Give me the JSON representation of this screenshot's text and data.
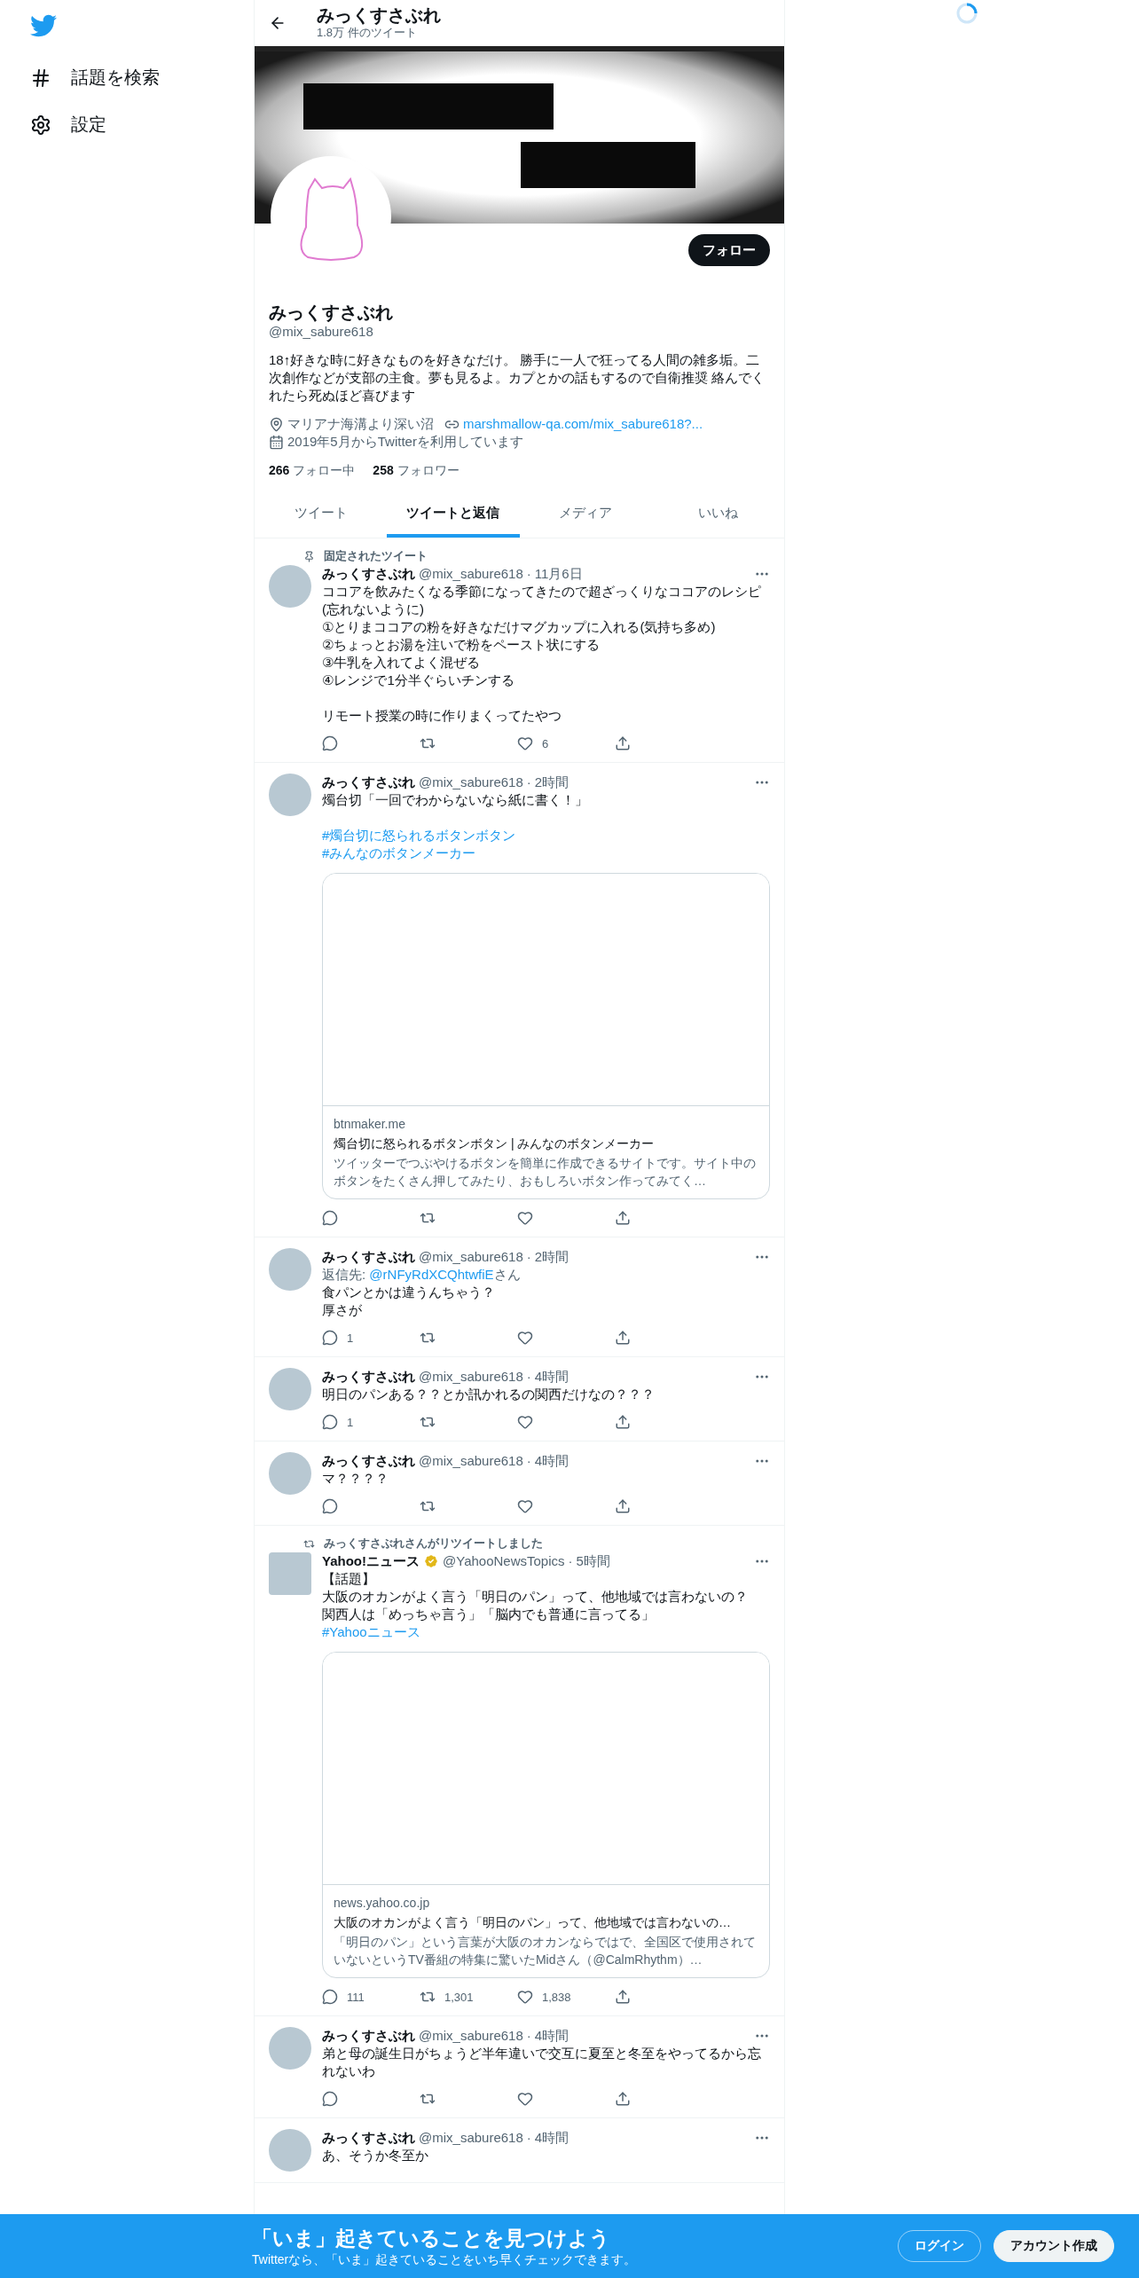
{
  "sidebar": {
    "nav": [
      {
        "kind": "hashtag",
        "label": "話題を検索"
      },
      {
        "kind": "settings",
        "label": "設定"
      }
    ]
  },
  "header": {
    "title": "みっくすさぶれ",
    "subtitle": "1.8万 件のツイート"
  },
  "profile": {
    "name": "みっくすさぶれ",
    "handle": "@mix_sabure618",
    "follow_button": "フォロー",
    "bio": "18↑好きな時に好きなものを好きなだけ。 勝手に一人で狂ってる人間の雑多垢。二次創作などが支部の主食。夢も見るよ。カプとかの話もするので自衛推奨 絡んでくれたら死ぬほど喜びます",
    "location": "マリアナ海溝より深い沼",
    "website": "marshmallow-qa.com/mix_sabure618?...",
    "joined": "2019年5月からTwitterを利用しています",
    "following_count": "266",
    "following_label": "フォロー中",
    "followers_count": "258",
    "followers_label": "フォロワー"
  },
  "tabs": [
    {
      "label": "ツイート",
      "selected": false
    },
    {
      "label": "ツイートと返信",
      "selected": true
    },
    {
      "label": "メディア",
      "selected": false
    },
    {
      "label": "いいね",
      "selected": false
    }
  ],
  "tweets": [
    {
      "context": {
        "kind": "pinned",
        "text": "固定されたツイート"
      },
      "avatar": {
        "kind": "circle"
      },
      "name": "みっくすさぶれ",
      "verified": false,
      "handle": "@mix_sabure618",
      "time": "11月6日",
      "separator": "·",
      "body": [
        {
          "kind": "text",
          "text": "ココアを飲みたくなる季節になってきたので超ざっくりなココアのレシピ(忘れないように)"
        },
        {
          "kind": "text",
          "text": "①とりまココアの粉を好きなだけマグカップに入れる(気持ち多め)"
        },
        {
          "kind": "text",
          "text": "②ちょっとお湯を注いで粉をペースト状にする"
        },
        {
          "kind": "text",
          "text": "③牛乳を入れてよく混ぜる"
        },
        {
          "kind": "text",
          "text": "④レンジで1分半ぐらいチンする"
        },
        {
          "kind": "gap"
        },
        {
          "kind": "text",
          "text": "リモート授業の時に作りまくってたやつ"
        }
      ],
      "actions": [
        {
          "kind": "reply"
        },
        {
          "kind": "retweet"
        },
        {
          "kind": "like",
          "count": "6"
        },
        {
          "kind": "share"
        }
      ]
    },
    {
      "avatar": {
        "kind": "circle"
      },
      "name": "みっくすさぶれ",
      "verified": false,
      "handle": "@mix_sabure618",
      "time": "2時間",
      "separator": "·",
      "body": [
        {
          "kind": "text",
          "text": "燭台切「一回でわからないなら紙に書く！」"
        },
        {
          "kind": "gap"
        },
        {
          "kind": "tag",
          "text": "#燭台切に怒られるボタンボタン"
        },
        {
          "kind": "tag",
          "text": "#みんなのボタンメーカー"
        }
      ],
      "card": {
        "domain": "btnmaker.me",
        "title": "燭台切に怒られるボタンボタン | みんなのボタンメーカー",
        "description": "ツイッターでつぶやけるボタンを簡単に作成できるサイトです。サイト中のボタンをたくさん押してみたり、おもしろいボタン作ってみてく…"
      },
      "actions": [
        {
          "kind": "reply"
        },
        {
          "kind": "retweet"
        },
        {
          "kind": "like"
        },
        {
          "kind": "share"
        }
      ]
    },
    {
      "avatar": {
        "kind": "circle"
      },
      "name": "みっくすさぶれ",
      "verified": false,
      "handle": "@mix_sabure618",
      "time": "2時間",
      "reply_to": {
        "prefix": "返信先: ",
        "handle": "@rNFyRdXCQhtwfiE",
        "suffix": "さん"
      },
      "separator": "·",
      "body": [
        {
          "kind": "text",
          "text": "食パンとかは違うんちゃう？"
        },
        {
          "kind": "text",
          "text": "厚さが"
        }
      ],
      "actions": [
        {
          "kind": "reply",
          "count": "1"
        },
        {
          "kind": "retweet"
        },
        {
          "kind": "like"
        },
        {
          "kind": "share"
        }
      ]
    },
    {
      "avatar": {
        "kind": "circle"
      },
      "name": "みっくすさぶれ",
      "verified": false,
      "handle": "@mix_sabure618",
      "time": "4時間",
      "separator": "·",
      "body": [
        {
          "kind": "text",
          "text": "明日のパンある？？とか訊かれるの関西だけなの？？？"
        }
      ],
      "actions": [
        {
          "kind": "reply",
          "count": "1"
        },
        {
          "kind": "retweet"
        },
        {
          "kind": "like"
        },
        {
          "kind": "share"
        }
      ]
    },
    {
      "avatar": {
        "kind": "circle"
      },
      "name": "みっくすさぶれ",
      "verified": false,
      "handle": "@mix_sabure618",
      "time": "4時間",
      "separator": "·",
      "body": [
        {
          "kind": "text",
          "text": "マ？？？？"
        }
      ],
      "actions": [
        {
          "kind": "reply"
        },
        {
          "kind": "retweet"
        },
        {
          "kind": "like"
        },
        {
          "kind": "share"
        }
      ]
    },
    {
      "context": {
        "kind": "retweet",
        "text": "みっくすさぶれさんがリツイートしました"
      },
      "avatar": {
        "kind": "square"
      },
      "name": "Yahoo!ニュース",
      "verified": true,
      "handle": "@YahooNewsTopics",
      "time": "5時間",
      "separator": "·",
      "body": [
        {
          "kind": "text",
          "text": "【話題】"
        },
        {
          "kind": "text",
          "text": "大阪のオカンがよく言う「明日のパン」って、他地域では言わないの？"
        },
        {
          "kind": "text",
          "text": "関西人は「めっちゃ言う」「脳内でも普通に言ってる」"
        },
        {
          "kind": "tag",
          "text": "#Yahooニュース"
        }
      ],
      "card": {
        "domain": "news.yahoo.co.jp",
        "title": "大阪のオカンがよく言う「明日のパン」って、他地域では言わないの…",
        "description": "「明日のパン」という言葉が大阪のオカンならではで、全国区で使用されていないというTV番組の特集に驚いたMidさん（@CalmRhythm）…"
      },
      "actions": [
        {
          "kind": "reply",
          "count": "111"
        },
        {
          "kind": "retweet",
          "count": "1,301"
        },
        {
          "kind": "like",
          "count": "1,838"
        },
        {
          "kind": "share"
        }
      ]
    },
    {
      "avatar": {
        "kind": "circle"
      },
      "name": "みっくすさぶれ",
      "verified": false,
      "handle": "@mix_sabure618",
      "time": "4時間",
      "separator": "·",
      "body": [
        {
          "kind": "text",
          "text": "弟と母の誕生日がちょうど半年違いで交互に夏至と冬至をやってるから忘れないわ"
        }
      ],
      "actions": [
        {
          "kind": "reply"
        },
        {
          "kind": "retweet"
        },
        {
          "kind": "like"
        },
        {
          "kind": "share"
        }
      ]
    },
    {
      "avatar": {
        "kind": "circle"
      },
      "name": "みっくすさぶれ",
      "verified": false,
      "handle": "@mix_sabure618",
      "time": "4時間",
      "separator": "·",
      "body": [
        {
          "kind": "text",
          "text": "あ、そうか冬至か"
        }
      ]
    }
  ],
  "bottom_bar": {
    "title": "「いま」起きていることを見つけよう",
    "subtitle": "Twitterなら、「いま」起きていることをいち早くチェックできます。",
    "login_button": "ログイン",
    "signup_button": "アカウント作成"
  }
}
